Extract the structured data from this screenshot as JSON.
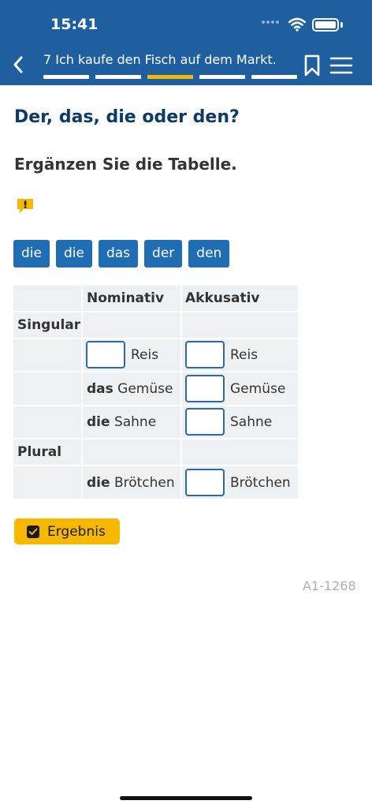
{
  "status_bar": {
    "time": "15:41"
  },
  "header": {
    "title": "7 Ich kaufe den Fisch auf dem Markt.",
    "progress_steps": 5,
    "active_step": 3
  },
  "exercise": {
    "heading": "Der, das, die oder den?",
    "instruction": "Ergänzen Sie die Tabelle."
  },
  "chips": [
    "die",
    "die",
    "das",
    "der",
    "den"
  ],
  "table": {
    "headers": {
      "nominativ": "Nominativ",
      "akkusativ": "Akkusativ"
    },
    "singular_label": "Singular",
    "plural_label": "Plural",
    "row1": {
      "nom_noun": "Reis",
      "akk_noun": "Reis"
    },
    "row2": {
      "nom_article": "das",
      "nom_noun": "Gemüse",
      "akk_noun": "Gemüse"
    },
    "row3": {
      "nom_article": "die",
      "nom_noun": "Sahne",
      "akk_noun": "Sahne"
    },
    "row4": {
      "nom_article": "die",
      "nom_noun": "Brötchen",
      "akk_noun": "Brötchen"
    }
  },
  "result_button": {
    "label": "Ergebnis"
  },
  "reference": "A1-1268",
  "colors": {
    "header": "#1f5f9f",
    "chip": "#1f6db3",
    "accent": "#f5b800",
    "heading": "#0d3a66"
  }
}
